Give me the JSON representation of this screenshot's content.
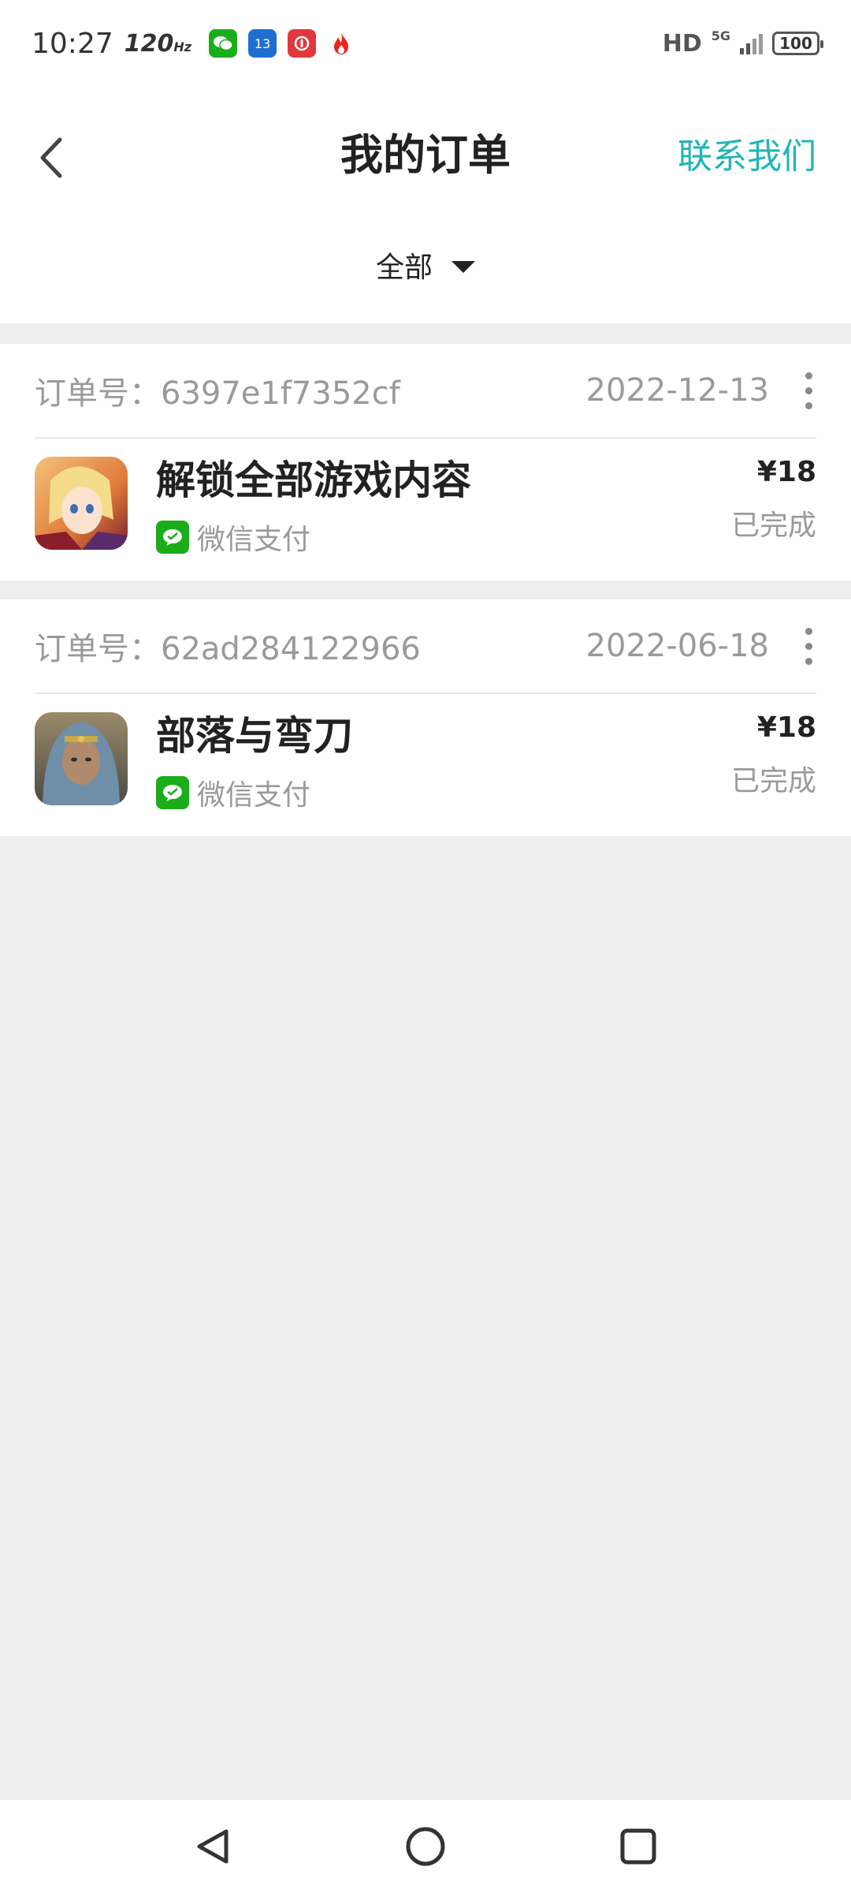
{
  "status_bar": {
    "time": "10:27",
    "refresh": "120",
    "refresh_unit": "Hz",
    "calendar_day": "13",
    "network": "HD",
    "net_type": "5G",
    "battery": "100"
  },
  "header": {
    "title": "我的订单",
    "contact": "联系我们",
    "filter": "全部"
  },
  "colors": {
    "accent": "#20b5b8",
    "wechat_green": "#1aad19",
    "background": "#ededed"
  },
  "orders": [
    {
      "order_no": "订单号：6397e1f7352cf",
      "date": "2022-12-13",
      "game": "解锁全部游戏内容",
      "payment": "微信支付",
      "price": "¥18",
      "status": "已完成"
    },
    {
      "order_no": "订单号：62ad284122966",
      "date": "2022-06-18",
      "game": "部落与弯刀",
      "payment": "微信支付",
      "price": "¥18",
      "status": "已完成"
    }
  ]
}
